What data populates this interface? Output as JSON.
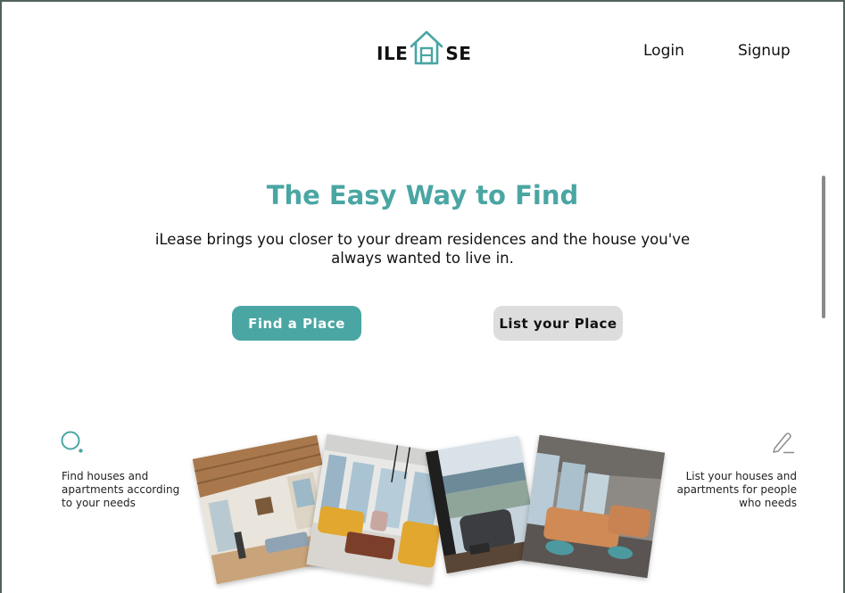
{
  "header": {
    "logo_left": "ILE",
    "logo_right": "SE",
    "logo_icon": "house-icon",
    "login_label": "Login",
    "signup_label": "Signup"
  },
  "hero": {
    "title": "The Easy Way to Find",
    "subtitle": "iLease brings you closer to your dream residences and the house you've always wanted to live in.",
    "primary_button": "Find a Place",
    "secondary_button": "List your Place"
  },
  "features": {
    "find": {
      "icon": "search-icon",
      "text": "Find houses and\napartments according\nto your needs"
    },
    "list": {
      "icon": "pencil-icon",
      "text": "List your houses and\napartments for people\nwho needs"
    }
  },
  "gallery": {
    "images": [
      {
        "name": "interior-photo-1",
        "subject": "living room with wooden ceiling"
      },
      {
        "name": "interior-photo-2",
        "subject": "apartment with yellow sofa"
      },
      {
        "name": "interior-photo-3",
        "subject": "balcony view with chair"
      },
      {
        "name": "interior-photo-4",
        "subject": "lounge with orange sofa"
      }
    ]
  },
  "colors": {
    "accent": "#4aa6a3",
    "secondary_button": "#dddddd",
    "frame": "#51625a"
  }
}
